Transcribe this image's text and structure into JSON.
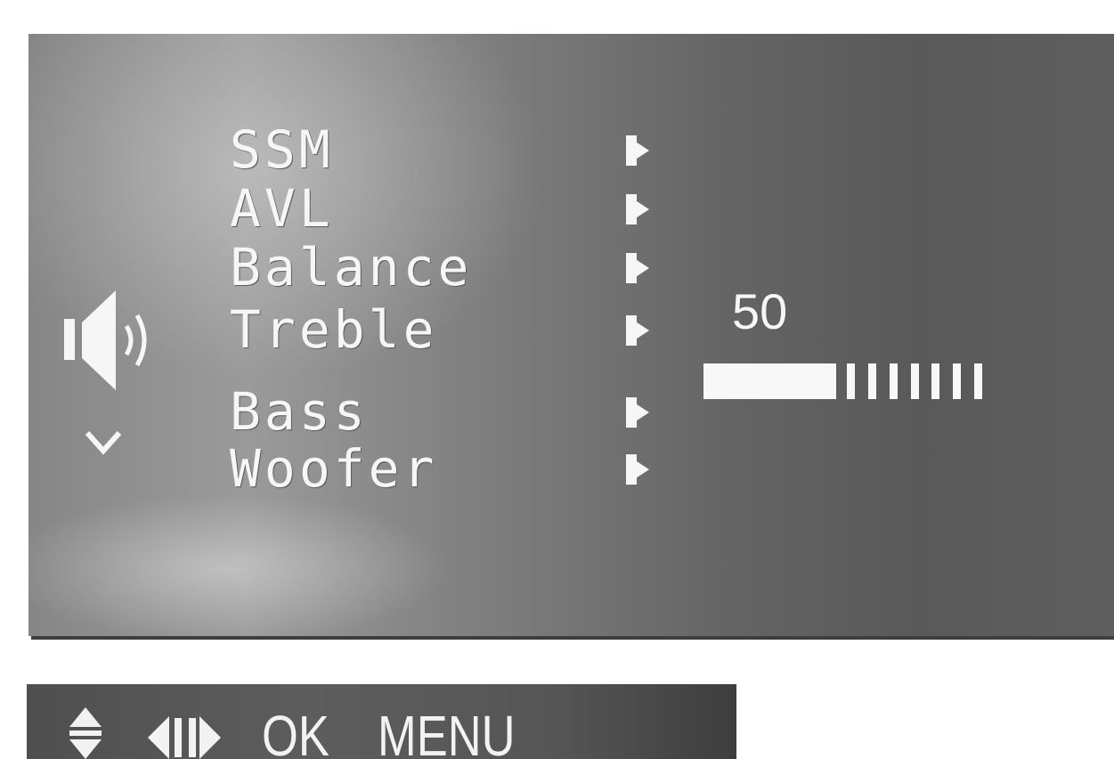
{
  "osd": {
    "menu_items": [
      {
        "label": "SSM"
      },
      {
        "label": "AVL"
      },
      {
        "label": "Balance"
      },
      {
        "label": "Treble"
      },
      {
        "label": "Bass"
      },
      {
        "label": "Woofer"
      }
    ],
    "icons": {
      "category": "speaker-icon",
      "scroll_more": "chevron-down-icon",
      "item_arrow": "triangle-right-icon"
    },
    "level": {
      "value_text": "50",
      "fraction": 0.5,
      "tick_count": 7
    }
  },
  "hint_bar": {
    "updown_icon": "up-down-arrows-icon",
    "leftright_icon": "left-right-arrows-icon",
    "ok_label": "OK",
    "menu_label": "MENU"
  },
  "colors": {
    "text": "#f6f6f6",
    "panel_dark": "#595959",
    "panel_light": "#9a9a9a",
    "hint_bar": "#555555"
  }
}
